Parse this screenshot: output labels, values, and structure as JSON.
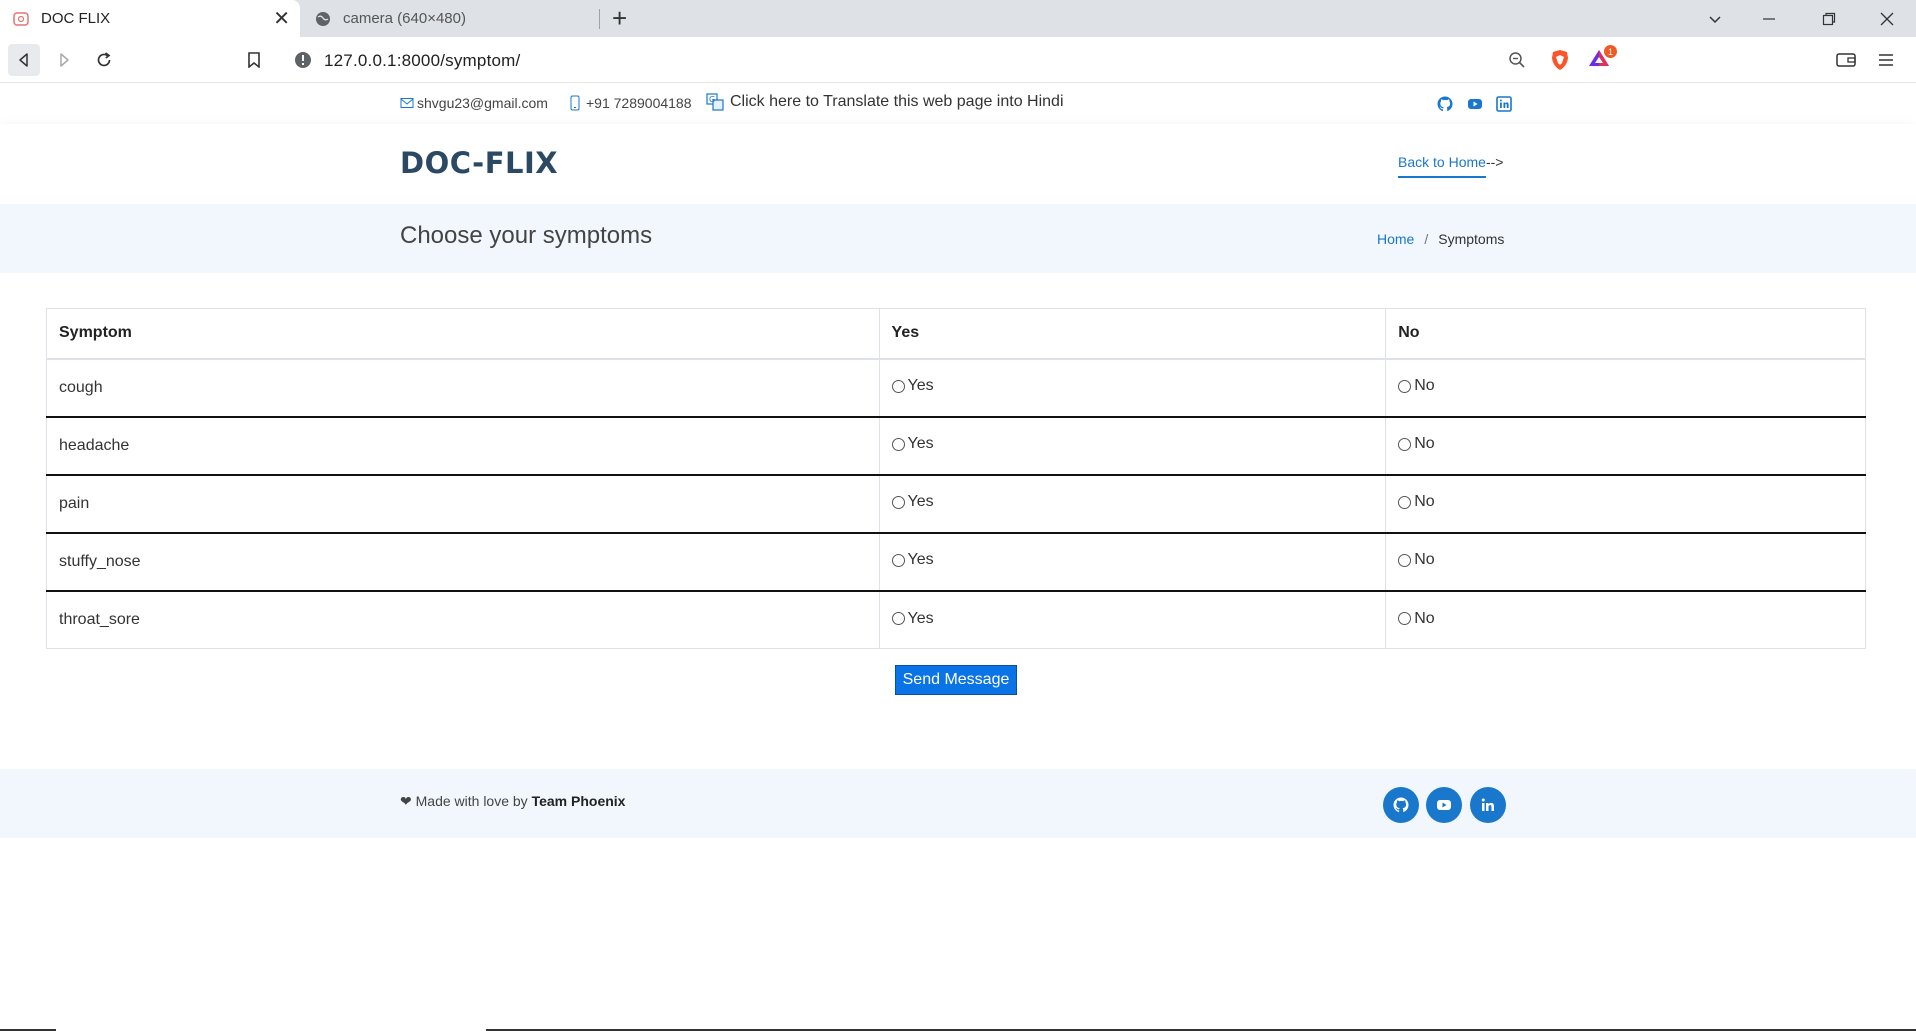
{
  "browser": {
    "tabs": [
      {
        "title": "DOC FLIX",
        "active": true
      },
      {
        "title": "camera (640×480)",
        "active": false
      }
    ],
    "url": "127.0.0.1:8000/symptom/",
    "brave_badge_count": "1"
  },
  "topbar": {
    "email": "shvgu23@gmail.com",
    "phone": "+91 7289004188",
    "translate_text": "Click here to Translate this web page into Hindi",
    "social_icons": [
      "github-icon",
      "youtube-icon",
      "linkedin-icon"
    ]
  },
  "header": {
    "logo": "DOC-FLIX",
    "back_link": "Back to Home",
    "back_arrow": "-->"
  },
  "breadcrumbs": {
    "title": "Choose your symptoms",
    "home": "Home",
    "separator": "/",
    "current": "Symptoms"
  },
  "table": {
    "headers": [
      "Symptom",
      "Yes",
      "No"
    ],
    "rows": [
      {
        "symptom": "cough",
        "yes": "Yes",
        "no": "No"
      },
      {
        "symptom": "headache",
        "yes": "Yes",
        "no": "No"
      },
      {
        "symptom": "pain",
        "yes": "Yes",
        "no": "No"
      },
      {
        "symptom": "stuffy_nose",
        "yes": "Yes",
        "no": "No"
      },
      {
        "symptom": "throat_sore",
        "yes": "Yes",
        "no": "No"
      }
    ]
  },
  "send_button": "Send Message",
  "footer": {
    "heart": "❤",
    "made_with": "Made with love by",
    "team": "Team Phoenix",
    "social_icons": [
      "github-icon",
      "youtube-icon",
      "linkedin-icon"
    ]
  },
  "colors": {
    "accent": "#1977cc",
    "logo": "#2c4964",
    "section_bg": "#f1f7fd",
    "button": "#0a73e6"
  }
}
